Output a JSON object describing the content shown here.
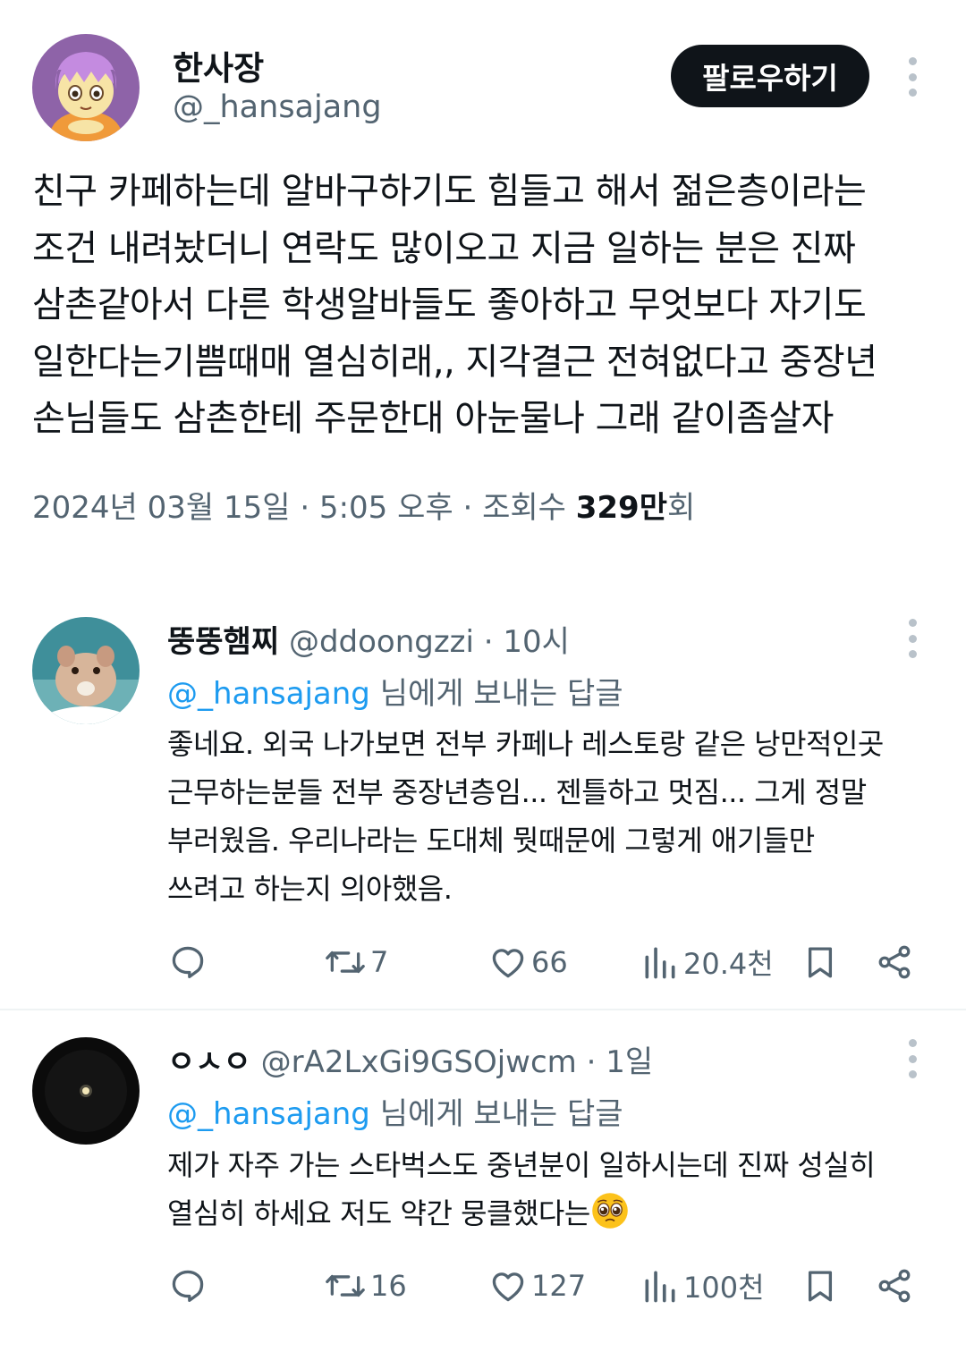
{
  "tweet": {
    "display_name": "한사장",
    "handle": "@_hansajang",
    "follow_label": "팔로우하기",
    "text_lines": [
      "친구 카페하는데 알바구하기도 힘들고 해서 젊은층이라는",
      "조건 내려놨더니 연락도 많이오고 지금 일하는 분은 진짜",
      "삼촌같아서 다른 학생알바들도 좋아하고 무엇보다 자기도",
      "일한다는기쁨때매 열심히래,, 지각결근 전혀없다고 중장년",
      "손님들도 삼촌한테 주문한대 아눈물나 그래 같이좀살자"
    ],
    "meta_prefix": "2024년 03월 15일 · 5:05 오후 · 조회수 ",
    "views": "329만",
    "views_suffix": "회"
  },
  "replies": [
    {
      "display_name": "뚱뚱햄찌",
      "handle": "@ddoongzzi",
      "time": " · 10시",
      "reply_to_mention": "@_hansajang",
      "reply_to_suffix": " 님에게 보내는 답글",
      "text_lines": [
        "좋네요. 외국 나가보면 전부 카페나 레스토랑 같은 낭만적인곳",
        "근무하는분들 전부 중장년층임... 젠틀하고 멋짐... 그게 정말",
        "부러웠음. 우리나라는 도대체 뭣때문에 그렇게 애기들만",
        "쓰려고 하는지 의아했음."
      ],
      "retweets": "7",
      "likes": "66",
      "views": "20.4천"
    },
    {
      "display_name": "ㅇㅅㅇ",
      "handle": "@rA2LxGi9GSOjwcm",
      "time": " · 1일",
      "reply_to_mention": "@_hansajang",
      "reply_to_suffix": " 님에게 보내는 답글",
      "text_lines": [
        "제가 자주 가는 스타벅스도 중년분이 일하시는데 진짜 성실히",
        "열심히 하세요 저도 약간 뭉클했다는"
      ],
      "emoji": "pleading-face-icon",
      "retweets": "16",
      "likes": "127",
      "views": "100천"
    }
  ],
  "colors": {
    "text": "#0f1419",
    "secondary": "#536471",
    "mention": "#1d9bf0",
    "button": "#0f1419"
  }
}
